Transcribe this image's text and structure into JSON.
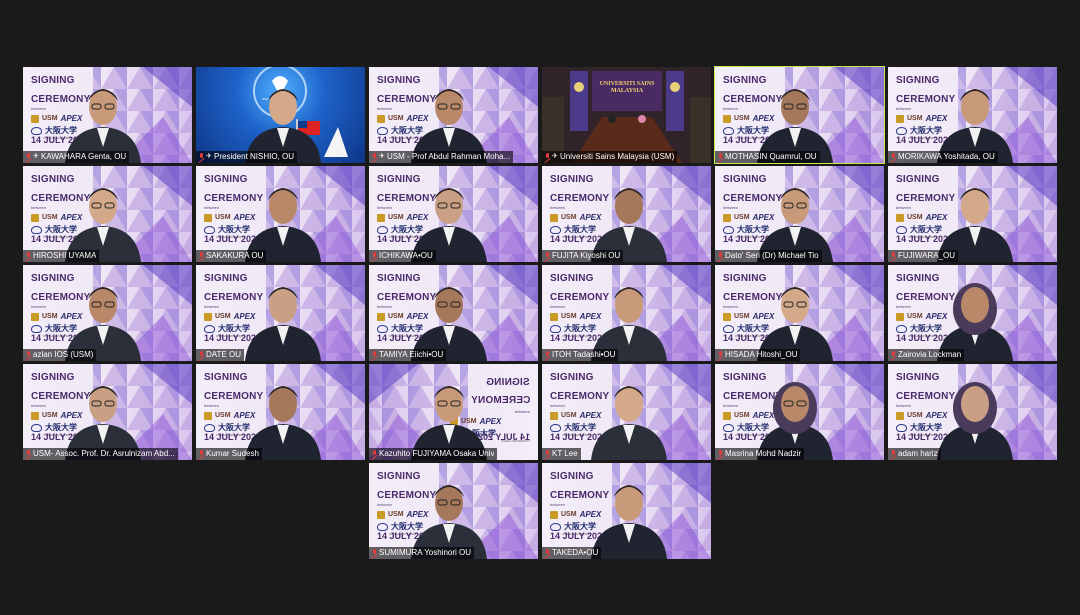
{
  "banner": {
    "line1": "SIGNING",
    "line2": "CEREMONY",
    "between": "between",
    "usm": "USM",
    "apex": "APEX",
    "osaka": "大阪大学",
    "osaka_sub": "OSAKA UNIVERSITY",
    "date": "14 JULY 2022"
  },
  "room": {
    "sign": "UNIVERSITI SAINS MALAYSIA"
  },
  "president": {
    "university_text": "OSAKA UNIVERSITY"
  },
  "participants": [
    {
      "name": "KAWAHARA Genta, OU"
    },
    {
      "name": "President NISHIO, OU"
    },
    {
      "name": "USM - Prof Abdul Rahman Moha..."
    },
    {
      "name": "Universiti Sains Malaysia (USM)"
    },
    {
      "name": "MOTHASIN Quamrul, OU"
    },
    {
      "name": "MORIKAWA Yoshitada, OU"
    },
    {
      "name": "HIROSHI UYAMA"
    },
    {
      "name": "SAKAKURA OU"
    },
    {
      "name": "ICHIKAWA•OU"
    },
    {
      "name": "FUJITA Kiyoshi OU"
    },
    {
      "name": "Dato' Seri (Dr) Michael Tio"
    },
    {
      "name": "FUJIWARA_OU"
    },
    {
      "name": "azlan IOS (USM)"
    },
    {
      "name": "DATE OU"
    },
    {
      "name": "TAMIYA Eiichi•OU"
    },
    {
      "name": "ITOH Tadashi•OU"
    },
    {
      "name": "HISADA Hitoshi_OU"
    },
    {
      "name": "Zairovia Lockman"
    },
    {
      "name": "USM- Assoc. Prof. Dr. Asrulnizam Abd..."
    },
    {
      "name": "Kumar Sudesh"
    },
    {
      "name": "Kazuhito FUJIYAMA Osaka Univ"
    },
    {
      "name": "KT Lee"
    },
    {
      "name": "Masrina Mohd Nadzir"
    },
    {
      "name": "adam hariz"
    },
    {
      "name": "SUMIMURA Yoshinori OU"
    },
    {
      "name": "TAKEDA•OU"
    }
  ]
}
